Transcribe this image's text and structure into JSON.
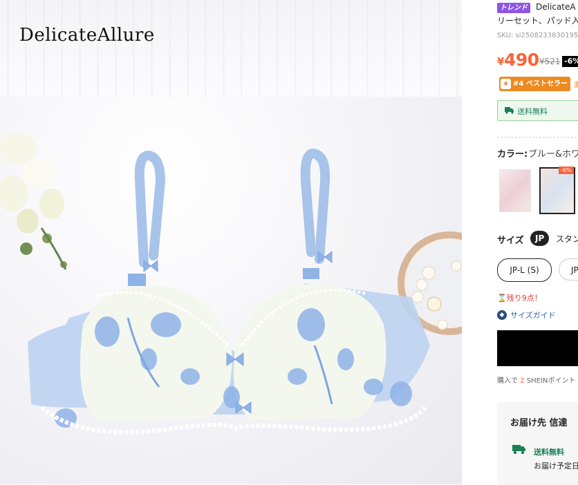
{
  "brand_logo": "DelicateAllure",
  "product": {
    "trend_badge": "トレンド",
    "title_line1": "DelicateA",
    "title_line2": "リーセット、パッド入り",
    "sku": "SKU: si2508233830195",
    "currency": "¥",
    "price": "490",
    "old_price": "¥521",
    "discount": "-6%",
    "best_seller": "#4 ベストセラー",
    "best_seller_suffix": "ま",
    "free_shipping": "送料無料"
  },
  "color": {
    "label": "カラー:",
    "value": "ブルー&ホワ",
    "swatch_badge": "-6%"
  },
  "size": {
    "label": "サイズ",
    "region": "JP",
    "standard": "スタン",
    "options": [
      "JP-L (S)",
      "JP"
    ]
  },
  "stock_note": "⌛残り9点！",
  "size_guide": "サイズガイド",
  "points_note": {
    "prefix": "購入で",
    "count": "2",
    "suffix": "SHEINポイント"
  },
  "delivery": {
    "title": "お届け先  信達",
    "shipping": "送料無料",
    "date_label": "お届け予定日"
  },
  "colors": {
    "accent": "#fa6338",
    "trend": "#8e55e6",
    "best": "#ee8a22",
    "ship_green": "#198055"
  },
  "icons": [
    "truck-icon",
    "medal-icon",
    "size-guide-icon",
    "hourglass-icon"
  ]
}
